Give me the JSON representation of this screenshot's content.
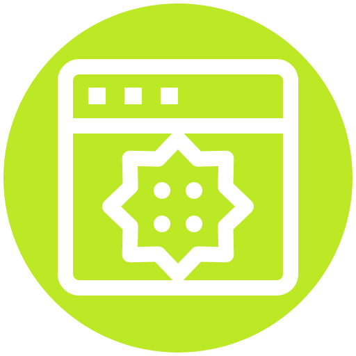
{
  "icon": {
    "name": "browser-window-settings-icon",
    "background_shape": "circle",
    "colors": {
      "circle_fill": "#BCE825",
      "stroke": "#FFFFFF",
      "page_background": "#FFFFFF"
    },
    "window": {
      "title_bar_dots": 3
    },
    "badge": {
      "shape": "eight-point-star",
      "dots": 4
    }
  }
}
